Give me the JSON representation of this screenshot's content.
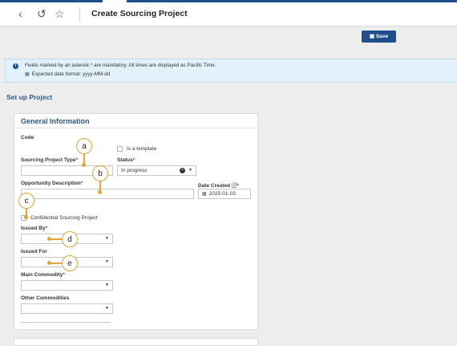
{
  "header": {
    "back_icon": "chevron-left-icon",
    "history_icon": "history-icon",
    "star_icon": "star-icon",
    "title": "Create Sourcing Project"
  },
  "toolbar": {
    "save_label": "Save",
    "save_icon": "save-icon"
  },
  "info": {
    "line1": "Fields marked by an asterisk * are mandatory. All times are displayed as Pacific Time.",
    "line2": "Expected date format: yyyy-MM-dd"
  },
  "section_title": "Set up Project",
  "general": {
    "title": "General Information",
    "code_label": "Code",
    "is_template_label": "Is a template",
    "sourcing_project_type_label": "Sourcing Project Type",
    "status_label": "Status",
    "status_value": "In progress",
    "opportunity_description_label": "Opportunity Description",
    "date_created_label": "Date Created",
    "date_created_value": "2025-01-03",
    "confidential_label": "Confidential Sourcing Project",
    "issued_by_label": "Issued By",
    "issued_for_label": "Issued For",
    "main_commodity_label": "Main Commodity",
    "other_commodities_label": "Other Commodities",
    "required_mark": "*"
  },
  "annotations": [
    "a",
    "b",
    "c",
    "d",
    "e"
  ],
  "colors": {
    "brand": "#1f4f8a",
    "accent": "#e3a431",
    "info_bg": "#e2f1fb",
    "section": "#2a5a8c"
  }
}
